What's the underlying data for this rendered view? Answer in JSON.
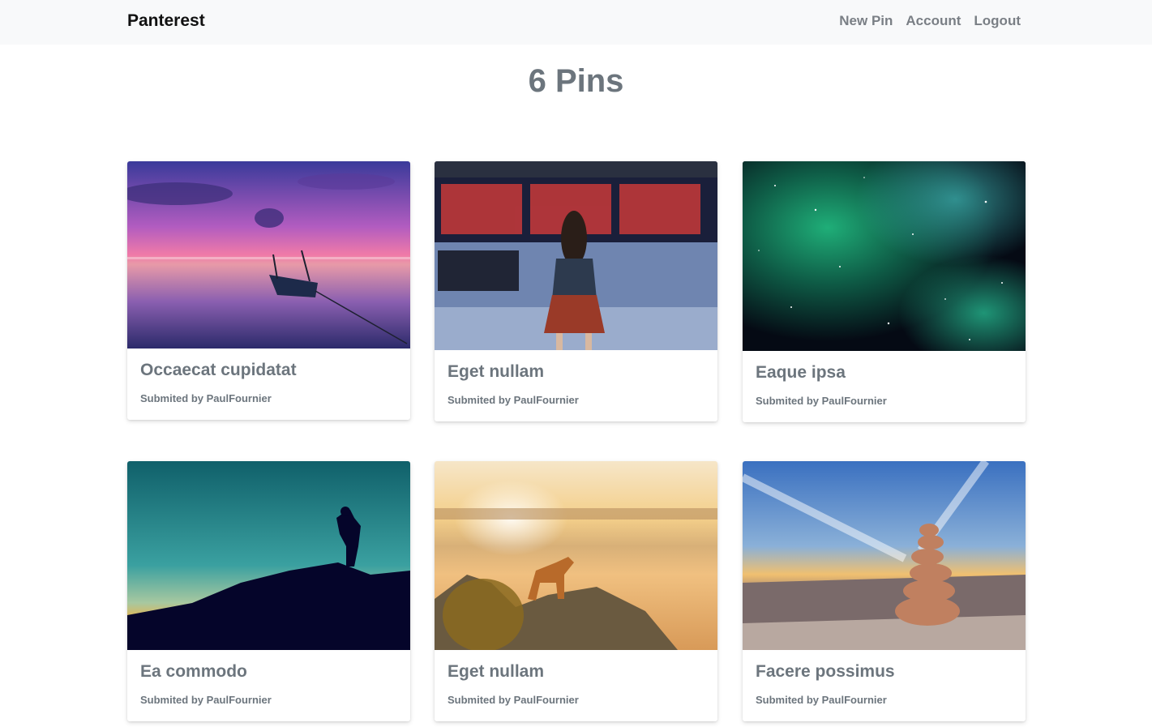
{
  "navbar": {
    "brand": "Panterest",
    "links": [
      "New Pin",
      "Account",
      "Logout"
    ]
  },
  "page": {
    "title": "6 Pins"
  },
  "pins": [
    {
      "title": "Occaecat cupidatat",
      "submitted": "Submited by PaulFournier",
      "image": "sunset-boat-lake"
    },
    {
      "title": "Eget nullam",
      "submitted": "Submited by PaulFournier",
      "image": "airport-departures-board"
    },
    {
      "title": "Eaque ipsa",
      "submitted": "Submited by PaulFournier",
      "image": "green-nebula-space"
    },
    {
      "title": "Ea commodo",
      "submitted": "Submited by PaulFournier",
      "image": "hiker-silhouette-teal-sky"
    },
    {
      "title": "Eget nullam",
      "submitted": "Submited by PaulFournier",
      "image": "dog-on-rocks-sunrise"
    },
    {
      "title": "Facere possimus",
      "submitted": "Submited by PaulFournier",
      "image": "stone-cairn-mountain-sunset"
    }
  ]
}
